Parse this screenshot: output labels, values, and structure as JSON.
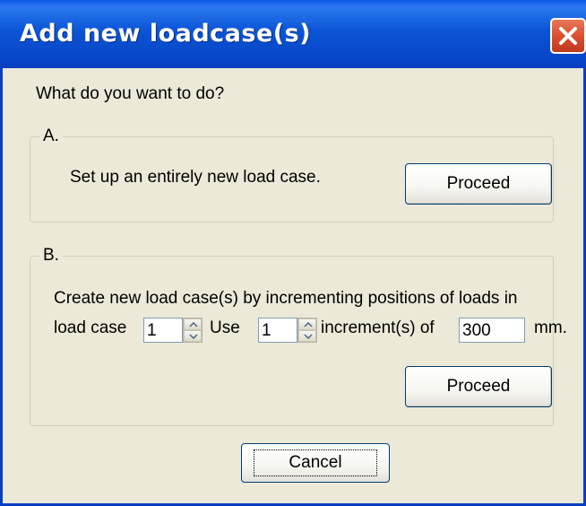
{
  "window": {
    "title": "Add new loadcase(s)",
    "close_icon": "close-icon"
  },
  "prompt": "What do you want to do?",
  "section_a": {
    "legend": "A.",
    "description": "Set up an entirely new load case.",
    "proceed_label": "Proceed"
  },
  "section_b": {
    "legend": "B.",
    "description_line1": "Create new load case(s) by incrementing positions of loads in",
    "load_case_label": "load case",
    "load_case_value": "1",
    "use_label": "Use",
    "use_value": "1",
    "increment_label": "increment(s) of",
    "increment_value": "300",
    "unit_label": "mm.",
    "proceed_label": "Proceed"
  },
  "cancel_label": "Cancel",
  "colors": {
    "title_bar": "#0b55d6",
    "close_button": "#d9502f",
    "dialog_bg": "#ece9d8"
  }
}
